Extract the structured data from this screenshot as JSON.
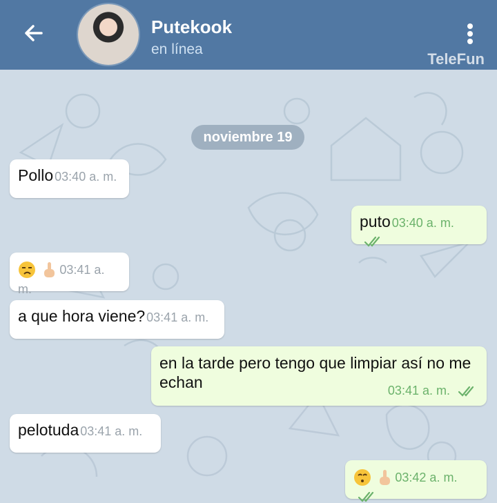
{
  "header": {
    "back_icon": "arrow-left-icon",
    "contact_name": "Putekook",
    "status": "en línea",
    "menu_icon": "kebab-menu-icon",
    "watermark": "TeleFun"
  },
  "chat": {
    "date": "noviembre 19",
    "messages": [
      {
        "dir": "in",
        "text": "Pollo",
        "time": "03:40 a. m."
      },
      {
        "dir": "out",
        "text": "puto",
        "time": "03:40 a. m.",
        "read": true
      },
      {
        "dir": "in",
        "emoji": [
          "unamused-face-icon",
          "middle-finger-icon"
        ],
        "time": "03:41 a. m."
      },
      {
        "dir": "in",
        "text": "a que hora viene?",
        "time": "03:41 a. m."
      },
      {
        "dir": "out",
        "text": "en la tarde pero tengo que limpiar así no me echan",
        "time": "03:41 a. m.",
        "read": true
      },
      {
        "dir": "in",
        "text": "pelotuda",
        "time": "03:41 a. m."
      },
      {
        "dir": "out",
        "emoji": [
          "kissing-face-icon",
          "middle-finger-icon"
        ],
        "time": "03:42 a. m.",
        "read": true
      }
    ]
  },
  "colors": {
    "header": "#5178a3",
    "background": "#cfdbe6",
    "incoming": "#ffffff",
    "outgoing": "#effdde",
    "check": "#6bb26b"
  }
}
